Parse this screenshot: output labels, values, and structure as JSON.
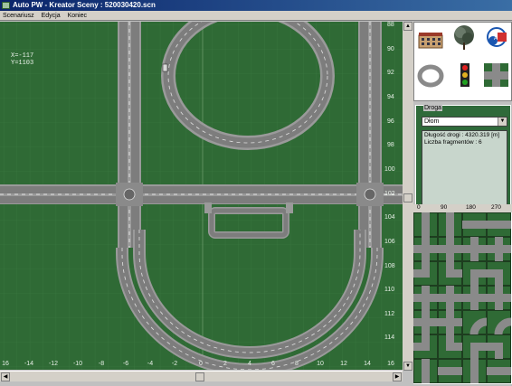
{
  "window": {
    "title": "Auto PW - Kreator Sceny : 520030420.scn"
  },
  "menu": {
    "items": [
      "Scenariusz",
      "Edycja",
      "Koniec"
    ]
  },
  "canvas": {
    "coord_x": "X=-117",
    "coord_y": "Y=1103",
    "x_ticks": [
      "16",
      "-14",
      "-12",
      "-10",
      "-8",
      "-6",
      "-4",
      "-2",
      "0",
      "2",
      "4",
      "6",
      "8",
      "10",
      "12",
      "14",
      "16"
    ],
    "y_ticks": [
      "88",
      "90",
      "92",
      "94",
      "96",
      "98",
      "100",
      "102",
      "104",
      "106",
      "108",
      "110",
      "112",
      "114"
    ]
  },
  "palette": {
    "items": [
      "building-icon",
      "tree-icon",
      "signs-icon",
      "oval-road-icon",
      "traffic-light-icon",
      "crossing-icon"
    ]
  },
  "road_panel": {
    "legend": "Droga",
    "selected": "Dłom",
    "length_label": "Długość drogi : 4320.319 [m]",
    "segments_label": "Liczba fragmentów : 6"
  },
  "tiles": {
    "angles": [
      "0",
      "90",
      "180",
      "270"
    ]
  },
  "colors": {
    "grass": "#2f6a35",
    "asphalt": "#8c8c8c",
    "titlebar": "#0a246a"
  }
}
